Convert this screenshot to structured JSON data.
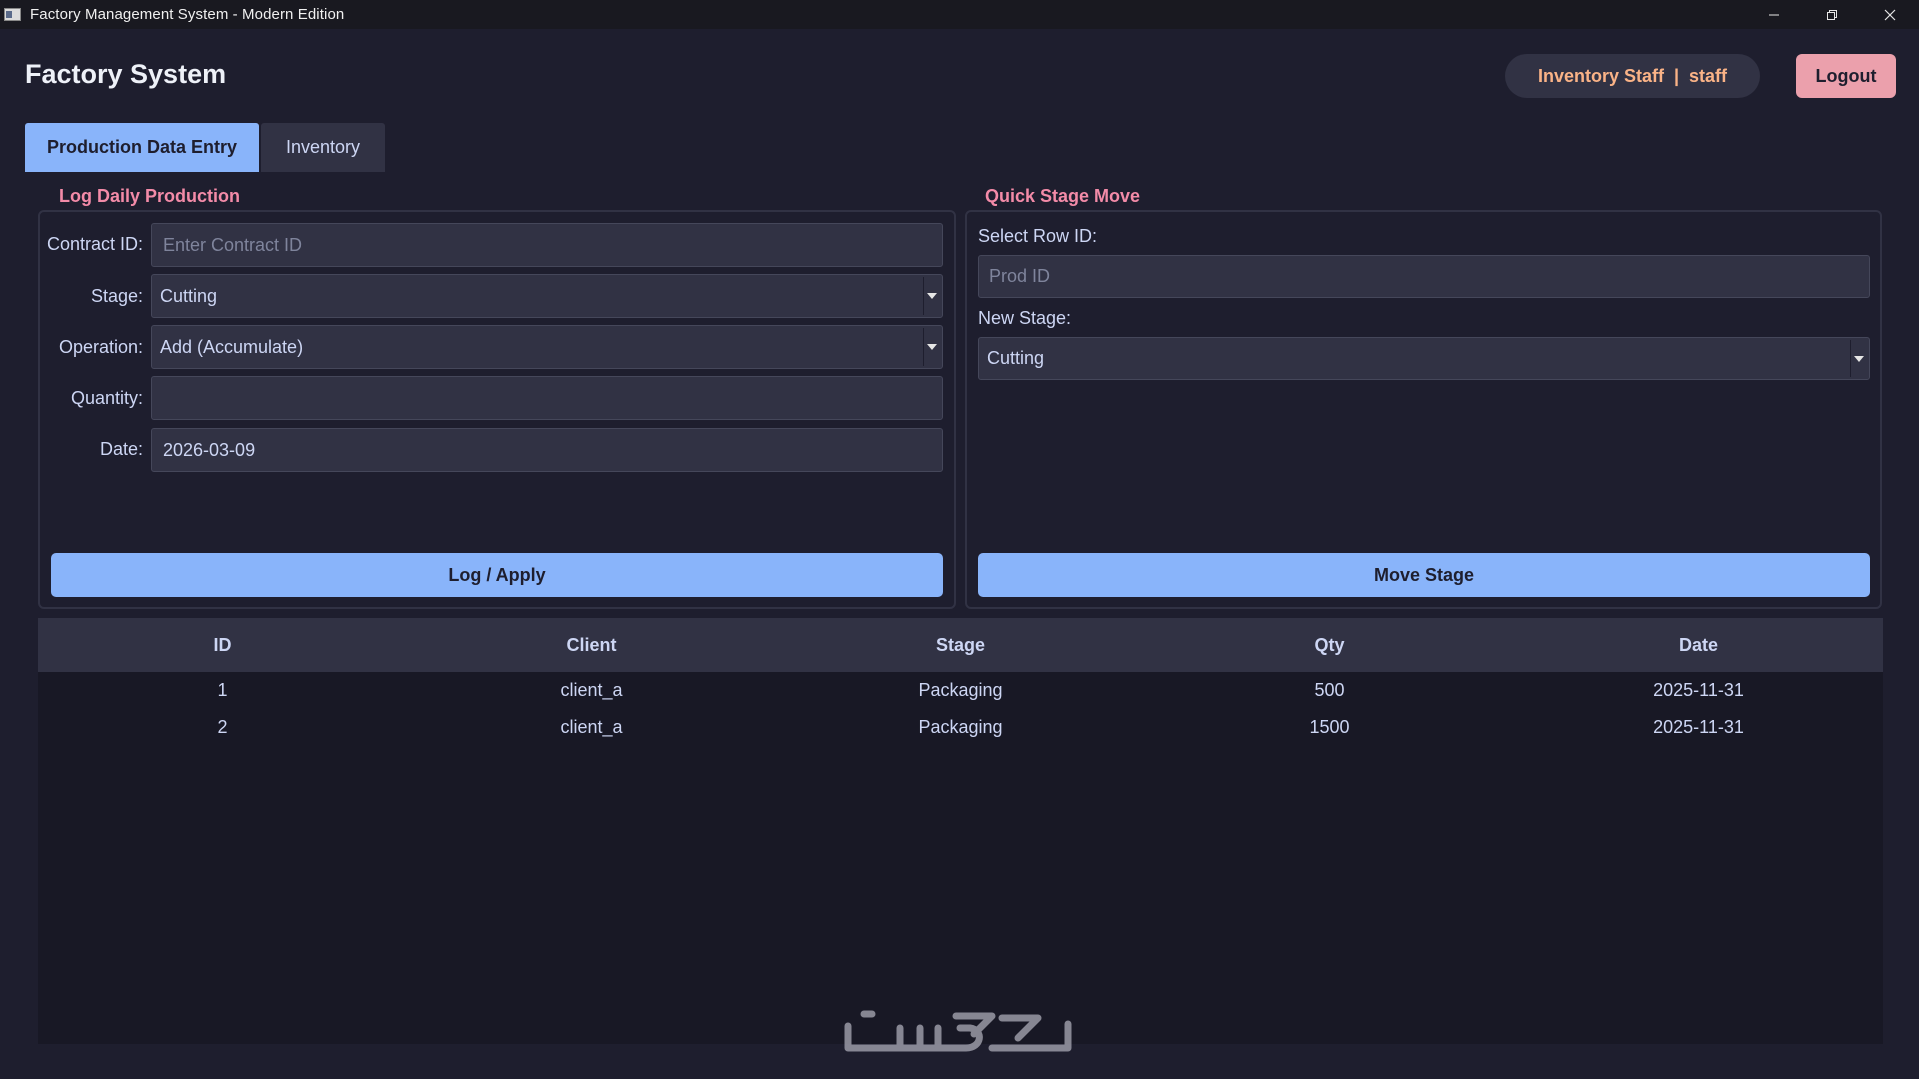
{
  "window": {
    "title": "Factory Management System - Modern Edition",
    "controls": [
      "minimize-icon",
      "restore-icon",
      "close-icon"
    ]
  },
  "header": {
    "app_title": "Factory System",
    "user_role": "Inventory Staff",
    "user_separator": "|",
    "username": "staff",
    "logout_label": "Logout"
  },
  "tabs": [
    {
      "label": "Production Data Entry",
      "active": true
    },
    {
      "label": "Inventory",
      "active": false
    }
  ],
  "log_production": {
    "title": "Log Daily Production",
    "contract_label": "Contract ID:",
    "contract_value": "",
    "contract_placeholder": "Enter Contract ID",
    "stage_label": "Stage:",
    "stage_value": "Cutting",
    "operation_label": "Operation:",
    "operation_value": "Add (Accumulate)",
    "quantity_label": "Quantity:",
    "quantity_value": "",
    "date_label": "Date:",
    "date_value": "2026-03-09",
    "submit_label": "Log / Apply"
  },
  "stage_move": {
    "title": "Quick Stage Move",
    "row_label": "Select Row ID:",
    "row_placeholder": "Prod ID",
    "new_stage_label": "New Stage:",
    "new_stage_value": "Cutting",
    "submit_label": "Move Stage"
  },
  "table": {
    "columns": [
      "ID",
      "Client",
      "Stage",
      "Qty",
      "Date"
    ],
    "rows": [
      [
        "1",
        "client_a",
        "Packaging",
        "500",
        "2025-11-31"
      ],
      [
        "2",
        "client_a",
        "Packaging",
        "1500",
        "2025-11-31"
      ]
    ]
  },
  "colors": {
    "background": "#1e1e2e",
    "surface": "#313244",
    "accent_blue": "#89b4fa",
    "accent_pink": "#f38ba8",
    "accent_peach": "#fab387",
    "logout": "#eba0ac"
  }
}
